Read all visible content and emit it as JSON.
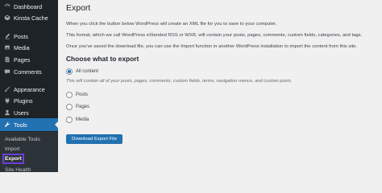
{
  "sidebar": {
    "items": [
      {
        "label": "Dashboard",
        "icon": "dashboard-icon"
      },
      {
        "label": "Kinsta Cache",
        "icon": "kinsta-cache-icon"
      },
      {
        "label": "Posts",
        "icon": "posts-icon"
      },
      {
        "label": "Media",
        "icon": "media-icon"
      },
      {
        "label": "Pages",
        "icon": "pages-icon"
      },
      {
        "label": "Comments",
        "icon": "comments-icon"
      },
      {
        "label": "Appearance",
        "icon": "appearance-icon"
      },
      {
        "label": "Plugins",
        "icon": "plugins-icon"
      },
      {
        "label": "Users",
        "icon": "users-icon"
      },
      {
        "label": "Tools",
        "icon": "tools-icon",
        "active": true
      }
    ],
    "submenu": [
      {
        "label": "Available Tools"
      },
      {
        "label": "Import"
      },
      {
        "label": "Export",
        "current": true
      },
      {
        "label": "Site Health"
      }
    ],
    "colors": {
      "background": "#1d2327",
      "active": "#2271b1",
      "submenu": "#2c3338",
      "highlight": "#6b3fd9"
    }
  },
  "main": {
    "title": "Export",
    "paragraphs": [
      "When you click the button below WordPress will create an XML file for you to save to your computer.",
      "This format, which we call WordPress eXtended RSS or WXR, will contain your posts, pages, comments, custom fields, categories, and tags.",
      "Once you've saved the download file, you can use the Import function in another WordPress installation to import the content from this site."
    ],
    "section_heading": "Choose what to export",
    "options": [
      {
        "label": "All content",
        "checked": true
      },
      {
        "label": "Posts",
        "checked": false
      },
      {
        "label": "Pages",
        "checked": false
      },
      {
        "label": "Media",
        "checked": false
      }
    ],
    "all_content_description": "This will contain all of your posts, pages, comments, custom fields, terms, navigation menus, and custom posts.",
    "download_button": "Download Export File",
    "accent_color": "#2271b1"
  }
}
